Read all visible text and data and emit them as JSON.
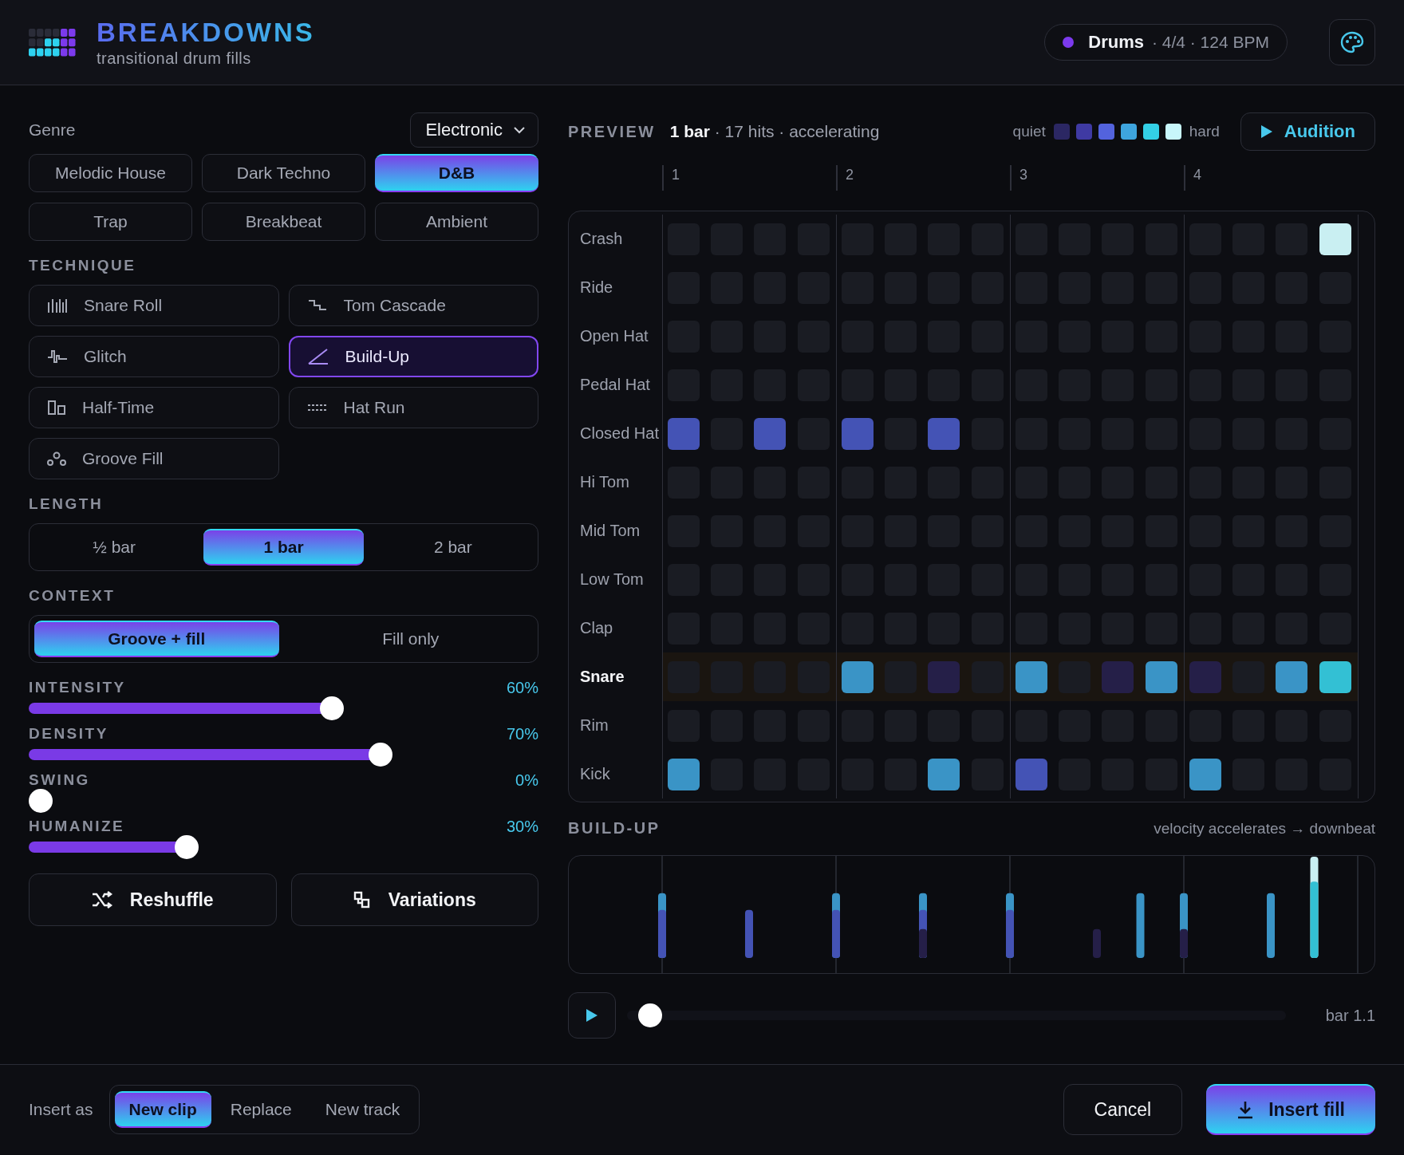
{
  "header": {
    "title": "BREAKDOWNS",
    "subtitle": "transitional drum fills",
    "track": {
      "color": "#7c3aed",
      "name": "Drums",
      "meta": "· 4/4 · 124 BPM"
    }
  },
  "genre": {
    "label": "Genre",
    "dropdown": "Electronic",
    "options": [
      {
        "label": "Melodic House",
        "selected": false
      },
      {
        "label": "Dark Techno",
        "selected": false
      },
      {
        "label": "D&B",
        "selected": true
      },
      {
        "label": "Trap",
        "selected": false
      },
      {
        "label": "Breakbeat",
        "selected": false
      },
      {
        "label": "Ambient",
        "selected": false
      }
    ]
  },
  "technique": {
    "title": "TECHNIQUE",
    "items": [
      {
        "label": "Snare Roll",
        "kind": "roll",
        "selected": false
      },
      {
        "label": "Tom Cascade",
        "kind": "cascade",
        "selected": false
      },
      {
        "label": "Glitch",
        "kind": "glitch",
        "selected": false
      },
      {
        "label": "Build-Up",
        "kind": "buildup",
        "selected": true
      },
      {
        "label": "Half-Time",
        "kind": "halftime",
        "selected": false
      },
      {
        "label": "Hat Run",
        "kind": "hatrun",
        "selected": false
      },
      {
        "label": "Groove Fill",
        "kind": "groove",
        "selected": false
      }
    ]
  },
  "length": {
    "title": "LENGTH",
    "options": [
      {
        "label": "½ bar",
        "selected": false
      },
      {
        "label": "1 bar",
        "selected": true
      },
      {
        "label": "2 bar",
        "selected": false
      }
    ]
  },
  "context": {
    "title": "CONTEXT",
    "options": [
      {
        "label": "Groove + fill",
        "selected": true
      },
      {
        "label": "Fill only",
        "selected": false
      }
    ]
  },
  "sliders": [
    {
      "label": "INTENSITY",
      "level": 0.6,
      "reading": "60%"
    },
    {
      "label": "DENSITY",
      "level": 0.7,
      "reading": "70%"
    },
    {
      "label": "SWING",
      "level": 0,
      "reading": "0%"
    },
    {
      "label": "HUMANIZE",
      "level": 0.3,
      "reading": "30%"
    }
  ],
  "actions": [
    {
      "label": "Reshuffle",
      "kind": "shuffle"
    },
    {
      "label": "Variations",
      "kind": "variations"
    }
  ],
  "preview": {
    "title": "PREVIEW",
    "summary": "**1 bar** · 17 hits · accelerating",
    "legend": {
      "low": "quiet",
      "high": "hard",
      "swatches": [
        {
          "color": "#2b2763"
        },
        {
          "color": "#3f3aa3"
        },
        {
          "color": "#5363dd"
        },
        {
          "color": "#3ea5de"
        },
        {
          "color": "#33d0e6"
        },
        {
          "color": "#c8f7fb"
        }
      ]
    },
    "audition": "Audition"
  },
  "beats": [
    "1",
    "2",
    "3",
    "4"
  ],
  "rows": [
    {
      "name": "Crash",
      "selected": false,
      "cells": [
        {
          "on": false
        },
        {
          "on": false
        },
        {
          "on": false
        },
        {
          "on": false
        },
        {
          "on": false
        },
        {
          "on": false
        },
        {
          "on": false
        },
        {
          "on": false
        },
        {
          "on": false
        },
        {
          "on": false
        },
        {
          "on": false
        },
        {
          "on": false
        },
        {
          "on": false
        },
        {
          "on": false
        },
        {
          "on": false
        },
        {
          "on": true,
          "color": "#c9eff2"
        }
      ]
    },
    {
      "name": "Ride",
      "selected": false,
      "cells": [
        {
          "on": false
        },
        {
          "on": false
        },
        {
          "on": false
        },
        {
          "on": false
        },
        {
          "on": false
        },
        {
          "on": false
        },
        {
          "on": false
        },
        {
          "on": false
        },
        {
          "on": false
        },
        {
          "on": false
        },
        {
          "on": false
        },
        {
          "on": false
        },
        {
          "on": false
        },
        {
          "on": false
        },
        {
          "on": false
        },
        {
          "on": false
        }
      ]
    },
    {
      "name": "Open Hat",
      "selected": false,
      "cells": [
        {
          "on": false
        },
        {
          "on": false
        },
        {
          "on": false
        },
        {
          "on": false
        },
        {
          "on": false
        },
        {
          "on": false
        },
        {
          "on": false
        },
        {
          "on": false
        },
        {
          "on": false
        },
        {
          "on": false
        },
        {
          "on": false
        },
        {
          "on": false
        },
        {
          "on": false
        },
        {
          "on": false
        },
        {
          "on": false
        },
        {
          "on": false
        }
      ]
    },
    {
      "name": "Pedal Hat",
      "selected": false,
      "cells": [
        {
          "on": false
        },
        {
          "on": false
        },
        {
          "on": false
        },
        {
          "on": false
        },
        {
          "on": false
        },
        {
          "on": false
        },
        {
          "on": false
        },
        {
          "on": false
        },
        {
          "on": false
        },
        {
          "on": false
        },
        {
          "on": false
        },
        {
          "on": false
        },
        {
          "on": false
        },
        {
          "on": false
        },
        {
          "on": false
        },
        {
          "on": false
        }
      ]
    },
    {
      "name": "Closed Hat",
      "selected": false,
      "cells": [
        {
          "on": true,
          "color": "#4453b5"
        },
        {
          "on": false
        },
        {
          "on": true,
          "color": "#4453b5"
        },
        {
          "on": false
        },
        {
          "on": true,
          "color": "#4453b5"
        },
        {
          "on": false
        },
        {
          "on": true,
          "color": "#4453b5"
        },
        {
          "on": false
        },
        {
          "on": false
        },
        {
          "on": false
        },
        {
          "on": false
        },
        {
          "on": false
        },
        {
          "on": false
        },
        {
          "on": false
        },
        {
          "on": false
        },
        {
          "on": false
        }
      ]
    },
    {
      "name": "Hi Tom",
      "selected": false,
      "cells": [
        {
          "on": false
        },
        {
          "on": false
        },
        {
          "on": false
        },
        {
          "on": false
        },
        {
          "on": false
        },
        {
          "on": false
        },
        {
          "on": false
        },
        {
          "on": false
        },
        {
          "on": false
        },
        {
          "on": false
        },
        {
          "on": false
        },
        {
          "on": false
        },
        {
          "on": false
        },
        {
          "on": false
        },
        {
          "on": false
        },
        {
          "on": false
        }
      ]
    },
    {
      "name": "Mid Tom",
      "selected": false,
      "cells": [
        {
          "on": false
        },
        {
          "on": false
        },
        {
          "on": false
        },
        {
          "on": false
        },
        {
          "on": false
        },
        {
          "on": false
        },
        {
          "on": false
        },
        {
          "on": false
        },
        {
          "on": false
        },
        {
          "on": false
        },
        {
          "on": false
        },
        {
          "on": false
        },
        {
          "on": false
        },
        {
          "on": false
        },
        {
          "on": false
        },
        {
          "on": false
        }
      ]
    },
    {
      "name": "Low Tom",
      "selected": false,
      "cells": [
        {
          "on": false
        },
        {
          "on": false
        },
        {
          "on": false
        },
        {
          "on": false
        },
        {
          "on": false
        },
        {
          "on": false
        },
        {
          "on": false
        },
        {
          "on": false
        },
        {
          "on": false
        },
        {
          "on": false
        },
        {
          "on": false
        },
        {
          "on": false
        },
        {
          "on": false
        },
        {
          "on": false
        },
        {
          "on": false
        },
        {
          "on": false
        }
      ]
    },
    {
      "name": "Clap",
      "selected": false,
      "cells": [
        {
          "on": false
        },
        {
          "on": false
        },
        {
          "on": false
        },
        {
          "on": false
        },
        {
          "on": false
        },
        {
          "on": false
        },
        {
          "on": false
        },
        {
          "on": false
        },
        {
          "on": false
        },
        {
          "on": false
        },
        {
          "on": false
        },
        {
          "on": false
        },
        {
          "on": false
        },
        {
          "on": false
        },
        {
          "on": false
        },
        {
          "on": false
        }
      ]
    },
    {
      "name": "Snare",
      "selected": true,
      "cells": [
        {
          "on": false
        },
        {
          "on": false
        },
        {
          "on": false
        },
        {
          "on": false
        },
        {
          "on": true,
          "color": "#3a94c6"
        },
        {
          "on": false
        },
        {
          "on": true,
          "color": "#251f48"
        },
        {
          "on": false
        },
        {
          "on": true,
          "color": "#3a94c6"
        },
        {
          "on": false
        },
        {
          "on": true,
          "color": "#251f48"
        },
        {
          "on": true,
          "color": "#3a94c6"
        },
        {
          "on": true,
          "color": "#251f48"
        },
        {
          "on": false
        },
        {
          "on": true,
          "color": "#3a94c6"
        },
        {
          "on": true,
          "color": "#33c0d4"
        }
      ]
    },
    {
      "name": "Rim",
      "selected": false,
      "cells": [
        {
          "on": false
        },
        {
          "on": false
        },
        {
          "on": false
        },
        {
          "on": false
        },
        {
          "on": false
        },
        {
          "on": false
        },
        {
          "on": false
        },
        {
          "on": false
        },
        {
          "on": false
        },
        {
          "on": false
        },
        {
          "on": false
        },
        {
          "on": false
        },
        {
          "on": false
        },
        {
          "on": false
        },
        {
          "on": false
        },
        {
          "on": false
        }
      ]
    },
    {
      "name": "Kick",
      "selected": false,
      "cells": [
        {
          "on": true,
          "color": "#3a94c6"
        },
        {
          "on": false
        },
        {
          "on": false
        },
        {
          "on": false
        },
        {
          "on": false
        },
        {
          "on": false
        },
        {
          "on": true,
          "color": "#3a94c6"
        },
        {
          "on": false
        },
        {
          "on": true,
          "color": "#4453b5"
        },
        {
          "on": false
        },
        {
          "on": false
        },
        {
          "on": false
        },
        {
          "on": true,
          "color": "#3a94c6"
        },
        {
          "on": false
        },
        {
          "on": false
        },
        {
          "on": false
        }
      ]
    }
  ],
  "buildup": {
    "title": "BUILD-UP",
    "note": "velocity accelerates → downbeat"
  },
  "transport": {
    "level": 0,
    "reading": "bar 1.1"
  },
  "footer": {
    "label": "Insert as",
    "modes": [
      {
        "label": "New clip",
        "selected": true
      },
      {
        "label": "Replace",
        "selected": false
      },
      {
        "label": "New track",
        "selected": false
      }
    ],
    "cancel": "Cancel",
    "insert": "Insert fill"
  }
}
